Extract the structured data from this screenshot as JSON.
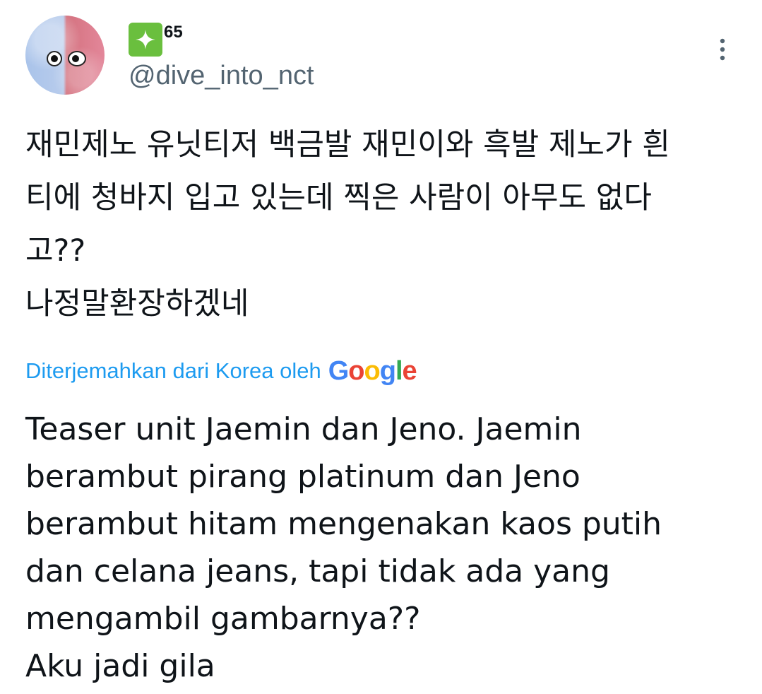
{
  "user": {
    "badge_count": "65",
    "handle": "@dive_into_nct"
  },
  "icons": {
    "avatar": "fluffy-two-tone-monster-avatar",
    "badge": "sparkle-icon",
    "more": "vertical-ellipsis-icon"
  },
  "tweet": {
    "original_text": "재민제노 유닛티저 백금발 재민이와 흑발 제노가 흰\n티에 청바지 입고 있는데 찍은 사람이 아무도 없다\n고??\n나정말환장하겠네",
    "translation_label": "Diterjemahkan dari Korea oleh",
    "translation_provider": "Google",
    "translated_text": "Teaser unit Jaemin dan Jeno. Jaemin\nberambut pirang platinum dan Jeno\nberambut hitam mengenakan kaos putih\ndan celana jeans, tapi tidak ada yang\nmengambil gambarnya??\nAku jadi gila"
  },
  "colors": {
    "text": "#0f1419",
    "secondary": "#536471",
    "link": "#1d9bf0",
    "badge_green": "#6abf3e"
  }
}
